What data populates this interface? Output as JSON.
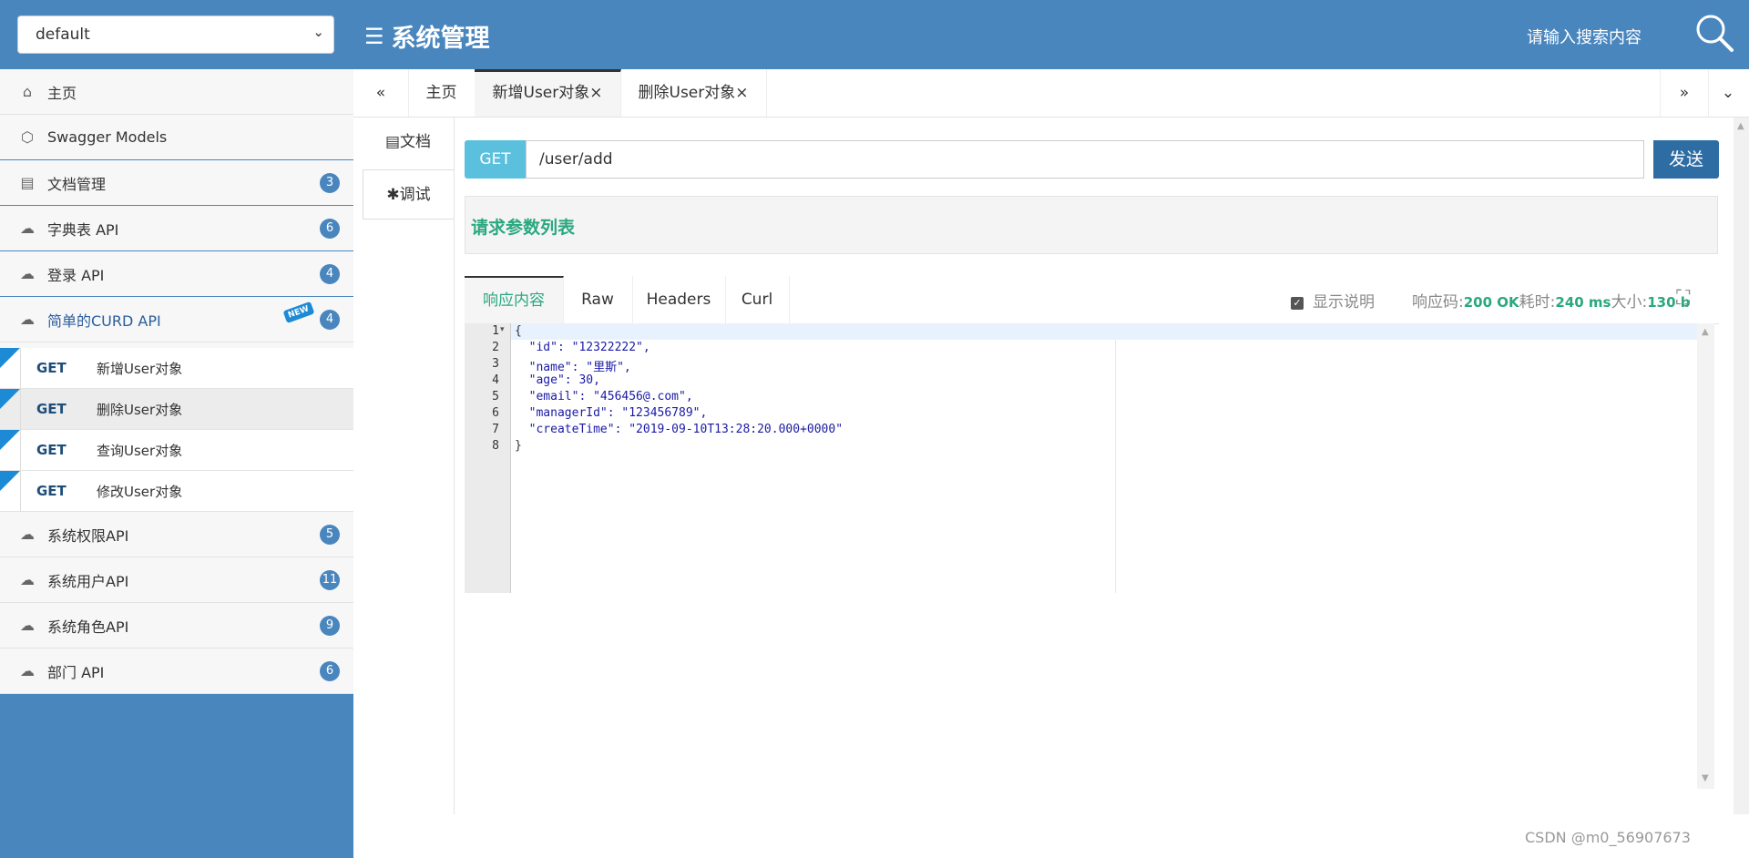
{
  "header": {
    "group_select_value": "default",
    "title": "系统管理",
    "search_placeholder": "请输入搜索内容"
  },
  "sidebar": {
    "items": [
      {
        "label": "主页",
        "icon": "home-icon"
      },
      {
        "label": "Swagger Models",
        "icon": "cube-icon"
      },
      {
        "label": "文档管理",
        "icon": "doc-settings-icon",
        "badge": "3"
      },
      {
        "label": "字典表 API",
        "icon": "cloud-api-icon",
        "badge": "6"
      },
      {
        "label": "登录 API",
        "icon": "cloud-api-icon",
        "badge": "4"
      },
      {
        "label": "简单的CURD API",
        "icon": "cloud-api-icon",
        "badge": "4",
        "new_tag": "NEW"
      }
    ],
    "subitems": [
      {
        "method": "GET",
        "label": "新增User对象"
      },
      {
        "method": "GET",
        "label": "删除User对象"
      },
      {
        "method": "GET",
        "label": "查询User对象"
      },
      {
        "method": "GET",
        "label": "修改User对象"
      }
    ],
    "items_after": [
      {
        "label": "系统权限API",
        "badge": "5"
      },
      {
        "label": "系统用户API",
        "badge": "11"
      },
      {
        "label": "系统角色API",
        "badge": "9"
      },
      {
        "label": "部门 API",
        "badge": "6"
      }
    ],
    "new_corner": "NEW"
  },
  "tabs": {
    "prev": "«",
    "next": "»",
    "dropdown": "⌄",
    "items": [
      {
        "label": "主页"
      },
      {
        "label": "新增User对象×"
      },
      {
        "label": "删除User对象×"
      }
    ]
  },
  "inner_tabs": {
    "doc": "文档",
    "debug": "调试"
  },
  "request": {
    "method": "GET",
    "url": "/user/add",
    "send": "发送",
    "params_title": "请求参数列表"
  },
  "response": {
    "tabs": [
      "响应内容",
      "Raw",
      "Headers",
      "Curl"
    ],
    "show_desc": "显示说明",
    "code_label": "响应码:",
    "code_value": "200 OK",
    "time_label": "耗时:",
    "time_value": "240 ms",
    "size_label": "大小:",
    "size_value": "130 b",
    "line_numbers": [
      "1",
      "2",
      "3",
      "4",
      "5",
      "6",
      "7",
      "8"
    ],
    "lines": [
      "{",
      "  \"id\": \"12322222\",",
      "  \"name\": \"里斯\",",
      "  \"age\": 30,",
      "  \"email\": \"456456@.com\",",
      "  \"managerId\": \"123456789\",",
      "  \"createTime\": \"2019-09-10T13:28:20.000+0000\"",
      "}"
    ]
  },
  "watermark": "CSDN @m0_56907673"
}
